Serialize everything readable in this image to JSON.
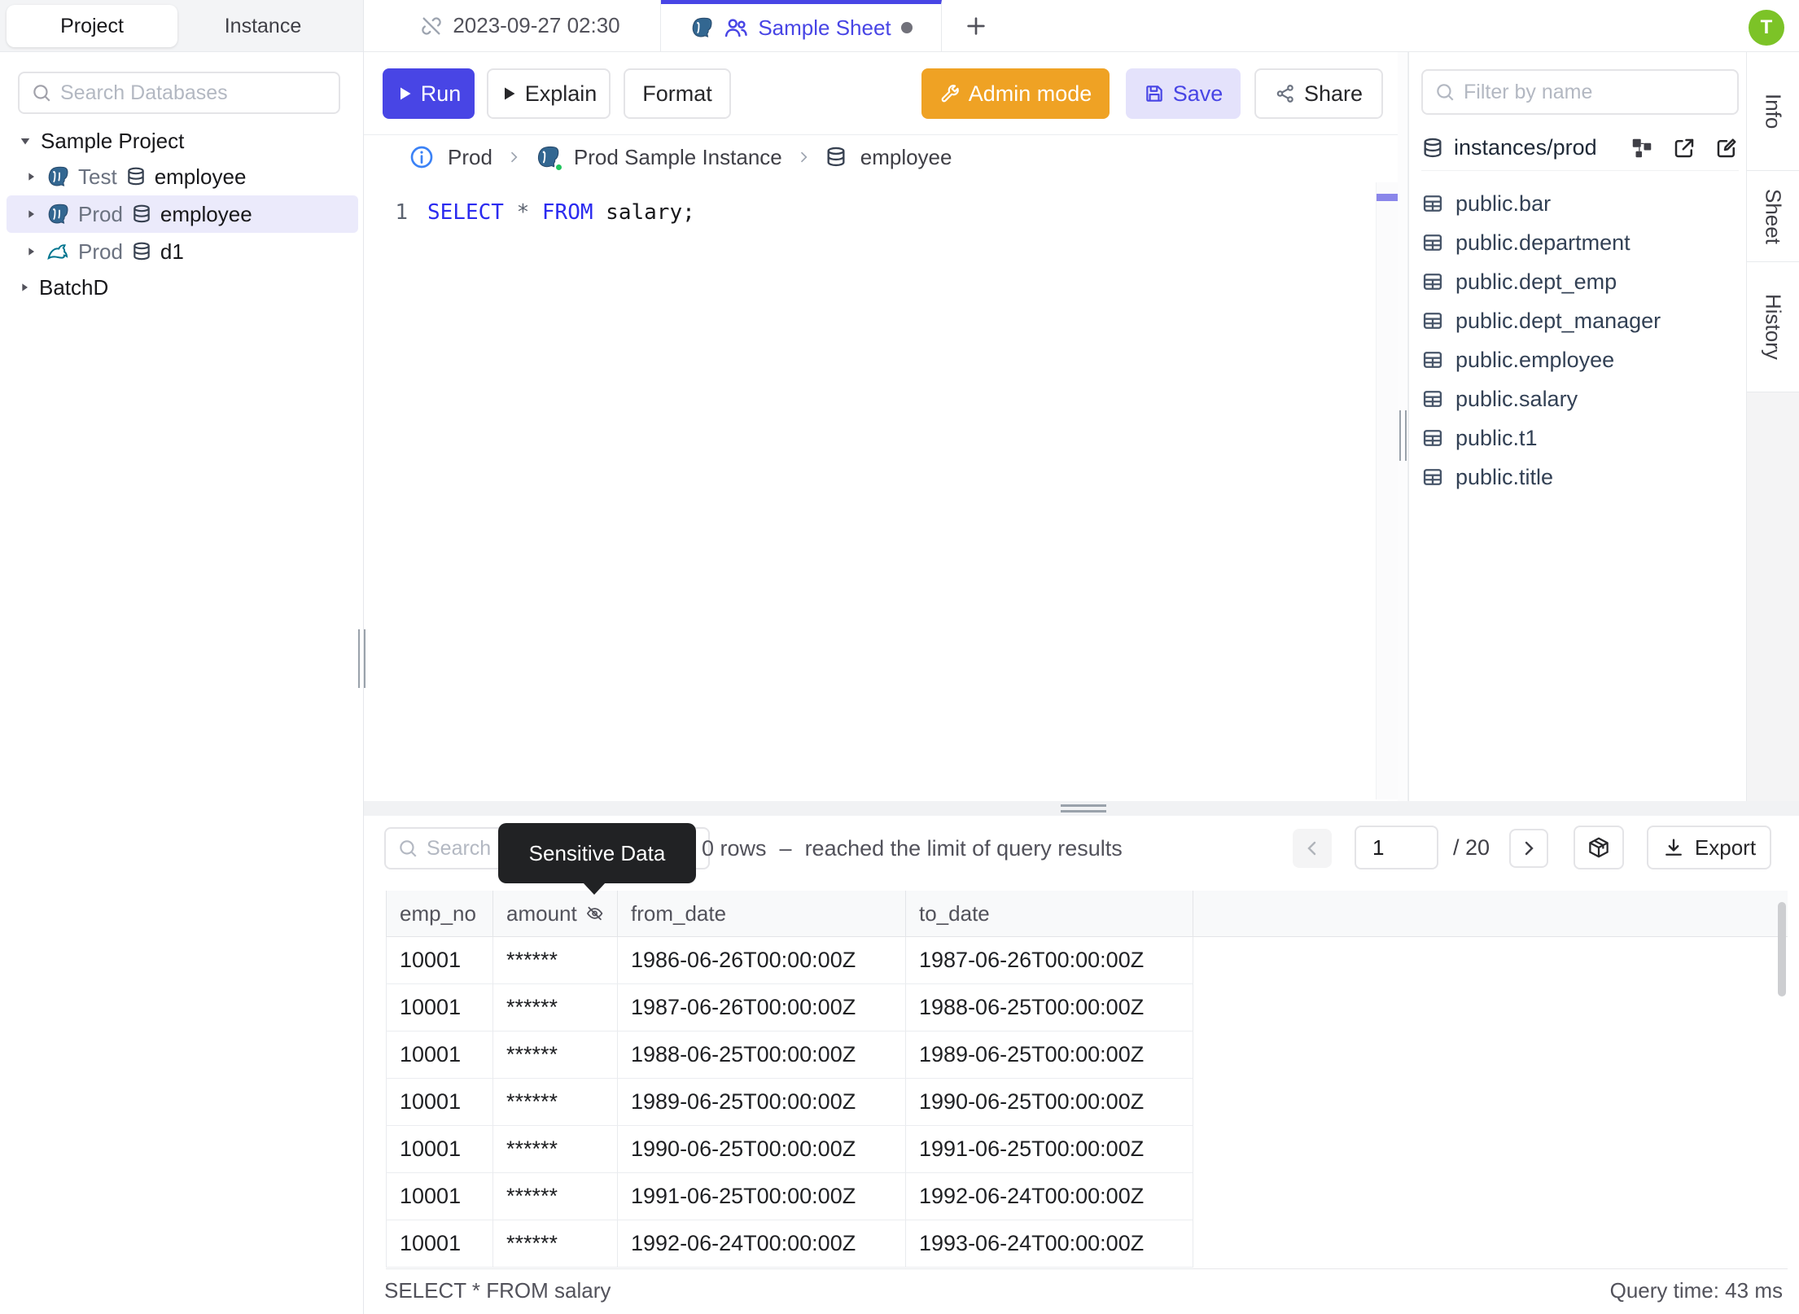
{
  "header": {
    "avatar_initial": "T"
  },
  "sidebar": {
    "tabs": {
      "project": "Project",
      "instance": "Instance"
    },
    "search_placeholder": "Search Databases",
    "tree": {
      "project_root": "Sample Project",
      "databases": [
        {
          "environment": "Test",
          "name": "employee",
          "engine": "postgresql"
        },
        {
          "environment": "Prod",
          "name": "employee",
          "engine": "postgresql"
        },
        {
          "environment": "Prod",
          "name": "d1",
          "engine": "mysql"
        }
      ],
      "batch_root": "BatchD"
    }
  },
  "tab_bar": {
    "sheet1_label": "2023-09-27 02:30",
    "sheet2_label": "Sample Sheet",
    "new_tab": "+"
  },
  "toolbar": {
    "run": "Run",
    "explain": "Explain",
    "format": "Format",
    "admin_mode": "Admin mode",
    "save": "Save",
    "share": "Share"
  },
  "breadcrumb": {
    "environment": "Prod",
    "instance": "Prod Sample Instance",
    "database": "employee"
  },
  "editor": {
    "line_number": "1",
    "sql": {
      "kw1": "SELECT",
      "star": "*",
      "kw2": "FROM",
      "rest": "salary;"
    }
  },
  "schema_panel": {
    "filter_placeholder": "Filter by name",
    "instance_path": "instances/prod",
    "tables": [
      "public.bar",
      "public.department",
      "public.dept_emp",
      "public.dept_manager",
      "public.employee",
      "public.salary",
      "public.t1",
      "public.title"
    ]
  },
  "side_tabs": {
    "info": "Info",
    "sheet": "Sheet",
    "history": "History"
  },
  "results": {
    "search_placeholder": "Search",
    "tooltip": "Sensitive Data",
    "row_count": "0 rows",
    "separator": "–",
    "limit_message": "reached the limit of query results",
    "pagination": {
      "page": "1",
      "total": "/ 20"
    },
    "export_label": "Export",
    "columns": [
      "emp_no",
      "amount",
      "from_date",
      "to_date"
    ],
    "rows": [
      [
        "10001",
        "******",
        "1986-06-26T00:00:00Z",
        "1987-06-26T00:00:00Z"
      ],
      [
        "10001",
        "******",
        "1987-06-26T00:00:00Z",
        "1988-06-25T00:00:00Z"
      ],
      [
        "10001",
        "******",
        "1988-06-25T00:00:00Z",
        "1989-06-25T00:00:00Z"
      ],
      [
        "10001",
        "******",
        "1989-06-25T00:00:00Z",
        "1990-06-25T00:00:00Z"
      ],
      [
        "10001",
        "******",
        "1990-06-25T00:00:00Z",
        "1991-06-25T00:00:00Z"
      ],
      [
        "10001",
        "******",
        "1991-06-25T00:00:00Z",
        "1992-06-24T00:00:00Z"
      ],
      [
        "10001",
        "******",
        "1992-06-24T00:00:00Z",
        "1993-06-24T00:00:00Z"
      ]
    ],
    "status_query": "SELECT * FROM salary",
    "status_time": "Query time: 43 ms"
  },
  "colors": {
    "accent_indigo": "#4845e5",
    "admin_orange": "#efa224",
    "avatar_green": "#7cc327",
    "keyword_blue": "#2b2bf0",
    "tooltip_bg": "#212224",
    "selected_row": "#ebeafb"
  }
}
